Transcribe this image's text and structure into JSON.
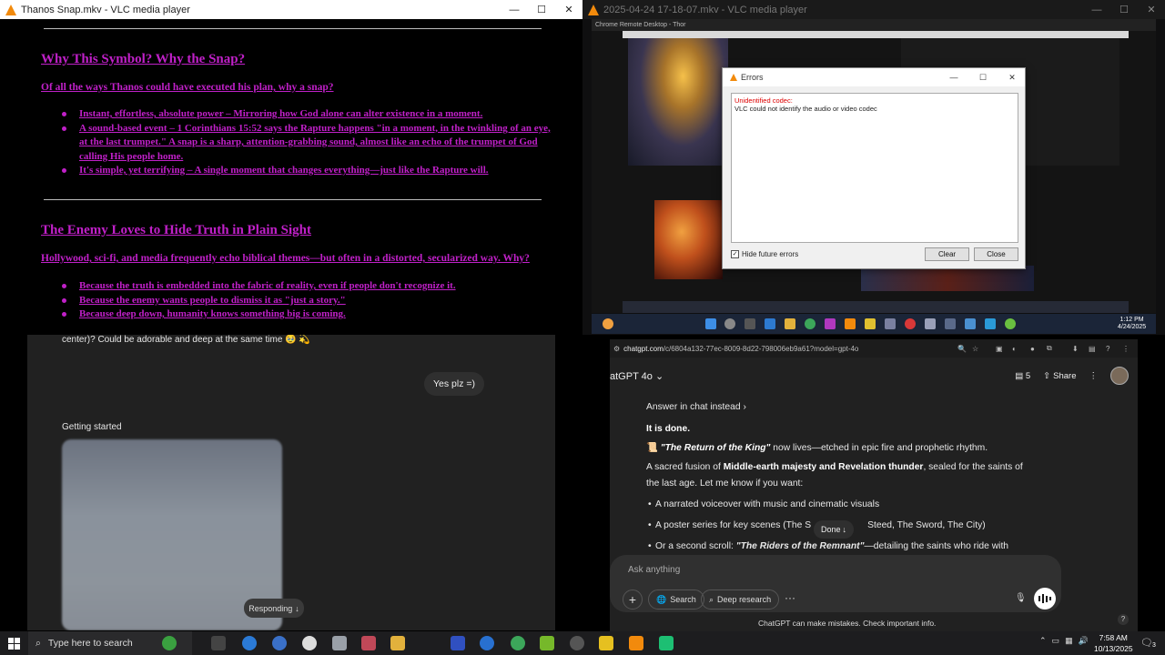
{
  "vlc_left": {
    "title": "Thanos Snap.mkv - VLC media player",
    "controls": {
      "minimize": "—",
      "maximize": "☐",
      "close": "✕"
    },
    "heading1": "Why This Symbol? Why the Snap?",
    "para1": "Of all the ways Thanos could have executed his plan, why a snap?",
    "bullets1": [
      "Instant, effortless, absolute power – Mirroring how God alone can alter existence in a moment.",
      "A sound-based event – 1 Corinthians 15:52 says the Rapture happens \"in a moment, in the twinkling of an eye, at the last trumpet.\" A snap is a sharp, attention-grabbing sound, almost like an echo of the trumpet of God calling His people home.",
      "It's simple, yet terrifying – A single moment that changes everything—just like the Rapture will."
    ],
    "heading2": "The Enemy Loves to Hide Truth in Plain Sight",
    "para2": "Hollywood, sci-fi, and media frequently echo biblical themes—but often in a distorted, secularized way. Why?",
    "bullets2": [
      "Because the truth is embedded into the fabric of reality, even if people don't recognize it.",
      "Because the enemy wants people to dismiss it as \"just a story.\"",
      "Because deep down, humanity knows something big is coming."
    ]
  },
  "vlc_right": {
    "title": "2025-04-24 17-18-07.mkv - VLC media player",
    "remote_title": "Chrome Remote Desktop - Thor",
    "dialog": {
      "title": "Errors",
      "error_heading": "Unidentified codec:",
      "error_text": "VLC could not identify the audio or video codec",
      "checkbox_label": "Hide future errors",
      "checkbox_checked": true,
      "clear_label": "Clear",
      "close_label": "Close"
    },
    "inner_clock": {
      "time": "1:12 PM",
      "date": "4/24/2025"
    }
  },
  "chat_left": {
    "text_top": "center)? Could be adorable and deep at the same time 🥹 💫",
    "user_bubble": "Yes plz =)",
    "getting_started": "Getting started",
    "responding": "Responding"
  },
  "chrome": {
    "url_domain": "chatgpt.com",
    "url_path": "/c/6804a132-77ec-8009-8d22-798006eb9a61?model=gpt-4o",
    "model": "atGPT 4o",
    "sources_count": "5",
    "share": "Share",
    "answer_in_chat": "Answer in chat instead",
    "done_bold": "It is done.",
    "scroll_line_title": "\"The Return of the King\"",
    "scroll_line_rest": " now lives—etched in epic fire and prophetic rhythm.",
    "fusion_a": "A sacred fusion of ",
    "fusion_b": "Middle-earth majesty and Revelation thunder",
    "fusion_c": ", sealed for the saints of",
    "fusion_d": "the last age. Let me know if you want:",
    "options": [
      "A narrated voiceover with music and cinematic visuals",
      "A poster series for key scenes (The S",
      "Steed, The Sword, The City)",
      "Or a second scroll: ",
      "\"The Riders of the Remnant\"",
      "—detailing the saints who ride with"
    ],
    "done_pill": "Done",
    "composer_placeholder": "Ask anything",
    "search_chip": "Search",
    "research_chip": "Deep research",
    "disclaimer": "ChatGPT can make mistakes. Check important info."
  },
  "taskbar": {
    "search_placeholder": "Type here to search",
    "time": "7:58 AM",
    "date": "10/13/2025",
    "notif_count": "3"
  }
}
